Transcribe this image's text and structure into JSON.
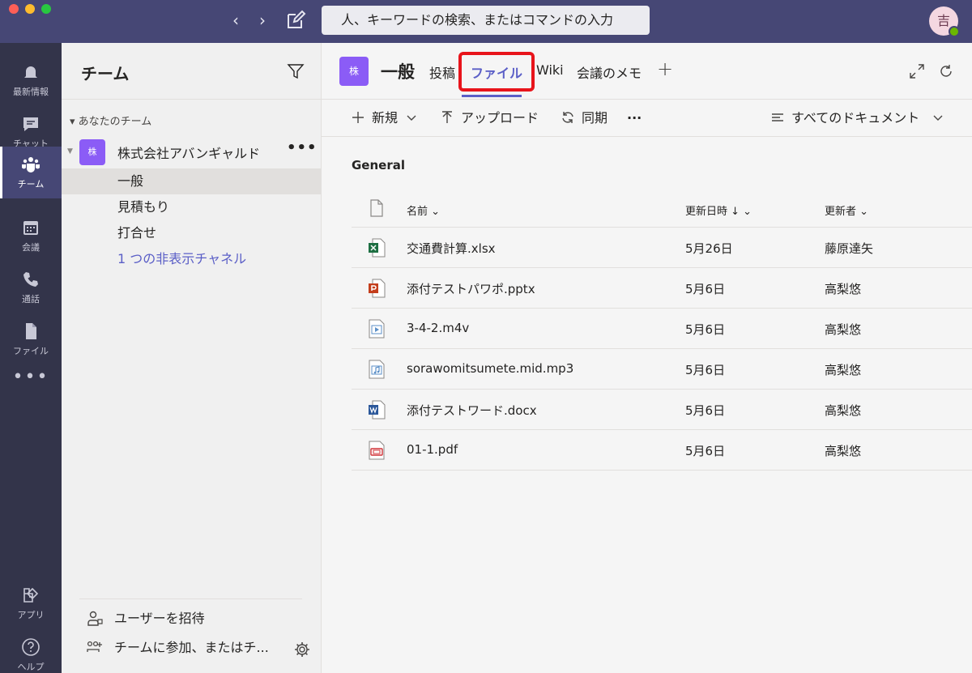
{
  "search": {
    "placeholder": "人、キーワードの検索、またはコマンドの入力"
  },
  "user": {
    "avatar_initial": "吉"
  },
  "appbar": {
    "items": [
      {
        "label": "最新情報",
        "icon": "bell-icon"
      },
      {
        "label": "チャット",
        "icon": "chat-icon"
      },
      {
        "label": "チーム",
        "icon": "teams-icon",
        "active": true
      },
      {
        "label": "会議",
        "icon": "calendar-icon"
      },
      {
        "label": "通話",
        "icon": "phone-icon"
      },
      {
        "label": "ファイル",
        "icon": "file-icon"
      }
    ],
    "more": "•••",
    "apps_label": "アプリ",
    "help_label": "ヘルプ"
  },
  "teams_pane": {
    "title": "チーム",
    "section": "あなたのチーム",
    "team": {
      "avatar": "株",
      "name": "株式会社アバンギャルド",
      "more": "•••"
    },
    "channels": [
      "一般",
      "見積もり",
      "打合せ"
    ],
    "hidden_channels": "1 つの非表示チャネル",
    "invite": "ユーザーを招待",
    "join": "チームに参加、またはチ..."
  },
  "channel": {
    "avatar": "株",
    "title": "一般",
    "tabs": [
      "投稿",
      "ファイル",
      "Wiki",
      "会議のメモ"
    ],
    "active_tab": "ファイル",
    "add": "+"
  },
  "toolbar": {
    "new": "新規",
    "upload": "アップロード",
    "sync": "同期",
    "more": "···",
    "view": "すべてのドキュメント"
  },
  "files": {
    "section": "General",
    "columns": {
      "name": "名前",
      "modified": "更新日時",
      "modified_by": "更新者"
    },
    "rows": [
      {
        "name": "交通費計算.xlsx",
        "modified": "5月26日",
        "by": "藤原達矢",
        "type": "excel"
      },
      {
        "name": "添付テストパワポ.pptx",
        "modified": "5月6日",
        "by": "高梨悠",
        "type": "powerpoint"
      },
      {
        "name": "3-4-2.m4v",
        "modified": "5月6日",
        "by": "高梨悠",
        "type": "video"
      },
      {
        "name": "sorawomitsumete.mid.mp3",
        "modified": "5月6日",
        "by": "高梨悠",
        "type": "audio"
      },
      {
        "name": "添付テストワード.docx",
        "modified": "5月6日",
        "by": "高梨悠",
        "type": "word"
      },
      {
        "name": "01-1.pdf",
        "modified": "5月6日",
        "by": "高梨悠",
        "type": "pdf"
      }
    ]
  },
  "colors": {
    "titlebar": "#464775",
    "appbar": "#33344a",
    "accent": "#5b5fc7",
    "highlight": "#e8141b",
    "team_avatar": "#8b5cf6"
  }
}
